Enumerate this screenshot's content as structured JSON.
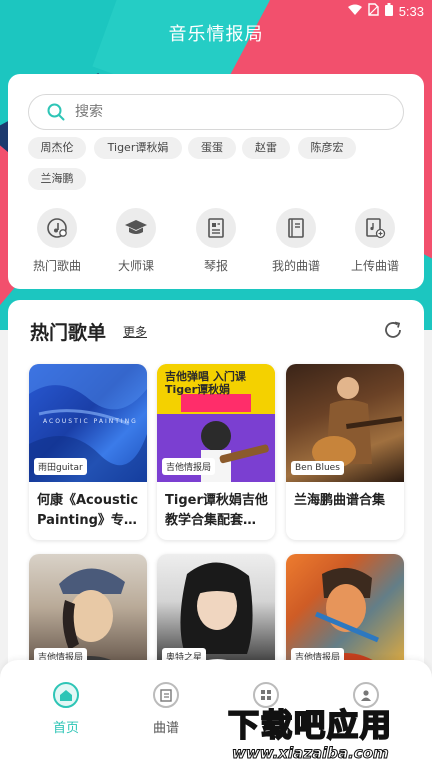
{
  "status_bar": {
    "time": "5:33"
  },
  "app": {
    "title": "音乐情报局"
  },
  "search": {
    "placeholder": "搜索"
  },
  "hot_searches": [
    "周杰伦",
    "Tiger谭秋娟",
    "蛋蛋",
    "赵雷",
    "陈彦宏",
    "兰海鹏"
  ],
  "quick_nav": [
    {
      "label": "热门歌曲",
      "icon": "music-note-icon"
    },
    {
      "label": "大师课",
      "icon": "graduation-cap-icon"
    },
    {
      "label": "琴报",
      "icon": "newspaper-icon"
    },
    {
      "label": "我的曲谱",
      "icon": "book-icon"
    },
    {
      "label": "上传曲谱",
      "icon": "upload-score-icon"
    }
  ],
  "hot_playlists": {
    "title": "热门歌单",
    "more_label": "更多",
    "items": [
      {
        "tag": "雨田guitar",
        "title": "何康《Acoustic Painting》专…",
        "image_text": "ACOUSTIC PAINTING"
      },
      {
        "tag": "吉他情报局",
        "title": "Tiger谭秋娟吉他教学合集配套…",
        "image_text": "吉他弹唱 入门课 Tiger谭秋娟"
      },
      {
        "tag": "Ben Blues",
        "title": "兰海鹏曲谱合集",
        "image_text": ""
      },
      {
        "tag": "吉他情报局",
        "title": "",
        "image_text": ""
      },
      {
        "tag": "奥特之星",
        "title": "",
        "image_text": ""
      },
      {
        "tag": "吉他情报局",
        "title": "",
        "image_text": ""
      }
    ]
  },
  "bottom_nav": [
    {
      "label": "首页",
      "icon": "home-icon",
      "active": true
    },
    {
      "label": "曲谱",
      "icon": "score-icon",
      "active": false
    },
    {
      "label": "",
      "icon": "grid-icon",
      "active": false
    },
    {
      "label": "",
      "icon": "profile-icon",
      "active": false
    }
  ],
  "watermark": {
    "text": "下载吧应用",
    "url": "www.xiazaiba.com"
  },
  "colors": {
    "accent": "#2ec5b6",
    "header_teal": "#1cc6c0",
    "header_pink": "#f2506d",
    "header_navy": "#1d3a6e"
  }
}
